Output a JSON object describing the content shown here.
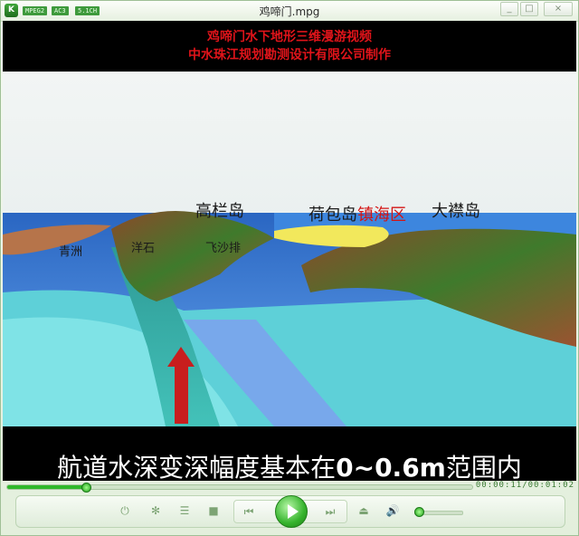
{
  "window": {
    "title": "鸡啼门.mpg",
    "badges": [
      "MPEG2",
      "AC3",
      "5.1CH"
    ],
    "app_icon": "K",
    "buttons": {
      "minimize": "_",
      "restore": "□",
      "close": "×"
    }
  },
  "video": {
    "top_caption_1": "鸡啼门水下地形三维漫游视频",
    "top_caption_2": "中水珠江规划勘测设计有限公司制作",
    "bottom_caption_prefix": "航道水深变深幅度基本在",
    "bottom_caption_bold": "0~0.6m",
    "bottom_caption_suffix": "范围内",
    "labels": {
      "gaolan": "高栏岛",
      "hebao": "荷包岛",
      "jinhai": "镇海区",
      "dajin": "大襟岛",
      "qingzhou": "青洲",
      "shishi": "洋石",
      "feiyi": "飞沙排"
    }
  },
  "playback": {
    "progress": 0.17,
    "time": "00:00:11/00:01:02",
    "volume": 0.1
  },
  "colors": {
    "accent": "#2fb82a",
    "caption_red": "#e0141a"
  },
  "icons": [
    "power-icon",
    "settings-icon",
    "playlist-icon",
    "stop-icon",
    "prev-icon",
    "play-icon",
    "next-icon",
    "eject-icon",
    "volume-icon"
  ]
}
